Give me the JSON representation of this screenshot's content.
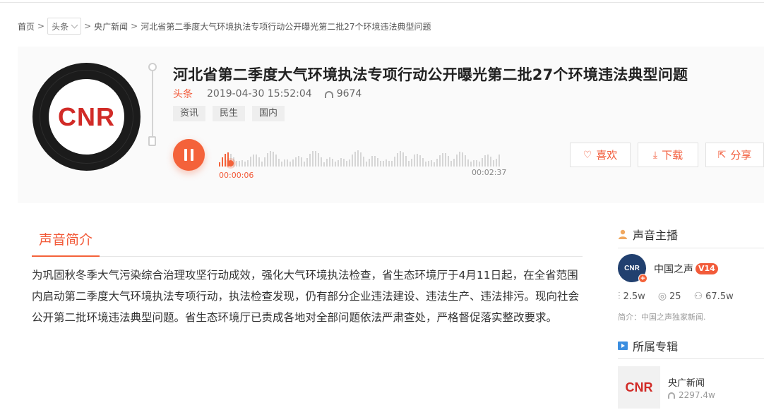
{
  "breadcrumb": {
    "home": "首页",
    "channel": "头条",
    "column": "央广新闻",
    "current": "河北省第二季度大气环境执法专项行动公开曝光第二批27个环境违法典型问题",
    "separator": ">"
  },
  "episode": {
    "cover_logo": "CNR",
    "title": "河北省第二季度大气环境执法专项行动公开曝光第二批27个环境违法典型问题",
    "category": "头条",
    "datetime": "2019-04-30 15:52:04",
    "plays": "9674",
    "tags": [
      "资讯",
      "民生",
      "国内"
    ]
  },
  "player": {
    "state": "playing",
    "current_time": "00:00:06",
    "total_time": "00:02:37",
    "progress": 0.038,
    "accent_color": "#f4623a"
  },
  "actions": {
    "like": "喜欢",
    "download": "下载",
    "share": "分享"
  },
  "intro": {
    "tab_label": "声音简介",
    "text": "为巩固秋冬季大气污染综合治理攻坚行动成效，强化大气环境执法检查，省生态环境厅于4月11日起，在全省范围内启动第二季度大气环境执法专项行动，执法检查发现，仍有部分企业违法建设、违法生产、违法排污。现向社会公开第二批环境违法典型问题。省生态环境厅已责成各地对全部问题依法严肃查处，严格督促落实整改要求。"
  },
  "host": {
    "heading": "声音主播",
    "avatar_text": "CNR",
    "name": "中国之声",
    "level": "V14",
    "stat_plays": "2.5w",
    "stat_tracks": "25",
    "stat_fans": "67.5w",
    "description": "简介：中国之声独家新闻."
  },
  "album": {
    "heading": "所属专辑",
    "cover_logo": "CNR",
    "name": "央广新闻",
    "plays": "2297.4w"
  }
}
